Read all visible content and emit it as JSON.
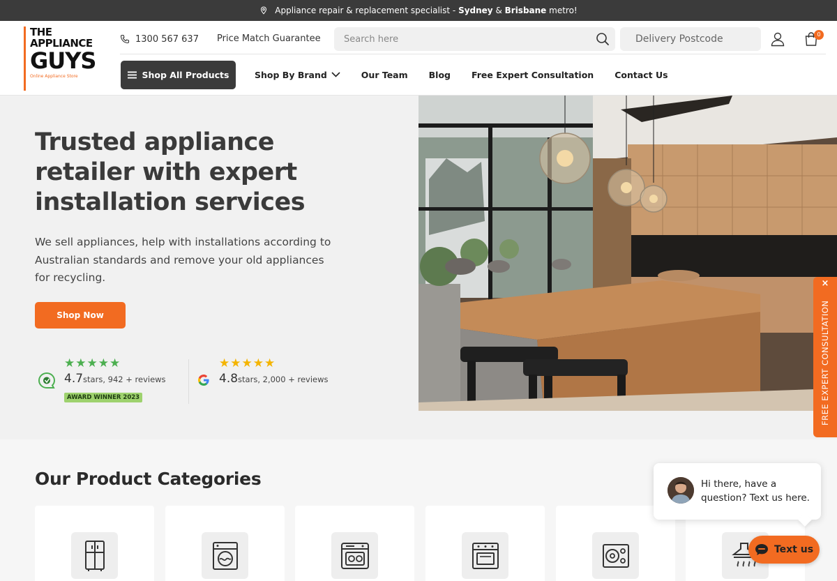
{
  "announcement": {
    "prefix": "Appliance repair & replacement specialist - ",
    "city1": "Sydney",
    "and": " & ",
    "city2": "Brisbane",
    "suffix": " metro!"
  },
  "logo": {
    "line1": "THE",
    "line2": "APPLIANCE",
    "line3": "GUYS",
    "tagline": "Online Appliance Store"
  },
  "header": {
    "phone": "1300 567 637",
    "price_match": "Price Match Guarantee",
    "search_placeholder": "Search here",
    "postcode_placeholder": "Delivery Postcode",
    "cart_count": "0"
  },
  "nav": {
    "shop_all": "Shop All Products",
    "items": [
      "Shop By Brand",
      "Our Team",
      "Blog",
      "Free Expert Consultation",
      "Contact Us"
    ]
  },
  "hero": {
    "title": "Trusted appliance retailer with expert installation services",
    "description": "We sell appliances, help with installations according to Australian standards and remove your old appliances for recycling.",
    "cta": "Shop Now"
  },
  "reviews": [
    {
      "stars": "★★★★★",
      "score": "4.7",
      "label": "stars, 942 + reviews",
      "badge": "AWARD WINNER 2023"
    },
    {
      "stars": "★★★★★",
      "score": "4.8",
      "label": "stars, 2,000 + reviews"
    }
  ],
  "side_tab": {
    "label": "FREE EXPERT CONSULTATION",
    "close": "×"
  },
  "categories": {
    "title": "Our Product Categories",
    "icons": [
      "fridge-icon",
      "washing-machine-icon",
      "dishwasher-icon",
      "oven-icon",
      "cooktop-icon",
      "rangehood-icon"
    ]
  },
  "chat": {
    "message": "Hi there, have a question? Text us here.",
    "button": "Text us"
  },
  "colors": {
    "accent": "#f26b21",
    "dark": "#3b3b3b",
    "green": "#4caf50",
    "gold": "#f4b400"
  }
}
